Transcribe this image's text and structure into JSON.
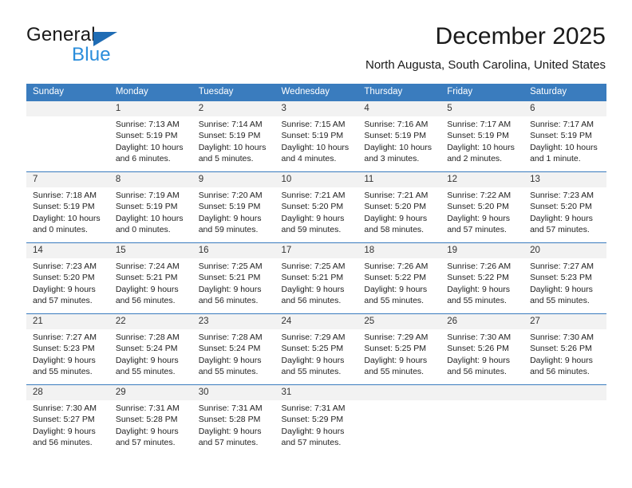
{
  "brand": {
    "word1": "General",
    "word2": "Blue",
    "triangle_color": "#1f6cb4",
    "blue_color": "#2a8ddb"
  },
  "header": {
    "title": "December 2025",
    "subtitle": "North Augusta, South Carolina, United States"
  },
  "theme": {
    "header_bg": "#3a7cbe",
    "header_text": "#ffffff",
    "daynum_bg": "#f2f2f2",
    "grid_line": "#3a7cbe"
  },
  "weekday_headers": [
    "Sunday",
    "Monday",
    "Tuesday",
    "Wednesday",
    "Thursday",
    "Friday",
    "Saturday"
  ],
  "weeks": [
    [
      {
        "day": "",
        "lines": []
      },
      {
        "day": "1",
        "lines": [
          "Sunrise: 7:13 AM",
          "Sunset: 5:19 PM",
          "Daylight: 10 hours",
          "and 6 minutes."
        ]
      },
      {
        "day": "2",
        "lines": [
          "Sunrise: 7:14 AM",
          "Sunset: 5:19 PM",
          "Daylight: 10 hours",
          "and 5 minutes."
        ]
      },
      {
        "day": "3",
        "lines": [
          "Sunrise: 7:15 AM",
          "Sunset: 5:19 PM",
          "Daylight: 10 hours",
          "and 4 minutes."
        ]
      },
      {
        "day": "4",
        "lines": [
          "Sunrise: 7:16 AM",
          "Sunset: 5:19 PM",
          "Daylight: 10 hours",
          "and 3 minutes."
        ]
      },
      {
        "day": "5",
        "lines": [
          "Sunrise: 7:17 AM",
          "Sunset: 5:19 PM",
          "Daylight: 10 hours",
          "and 2 minutes."
        ]
      },
      {
        "day": "6",
        "lines": [
          "Sunrise: 7:17 AM",
          "Sunset: 5:19 PM",
          "Daylight: 10 hours",
          "and 1 minute."
        ]
      }
    ],
    [
      {
        "day": "7",
        "lines": [
          "Sunrise: 7:18 AM",
          "Sunset: 5:19 PM",
          "Daylight: 10 hours",
          "and 0 minutes."
        ]
      },
      {
        "day": "8",
        "lines": [
          "Sunrise: 7:19 AM",
          "Sunset: 5:19 PM",
          "Daylight: 10 hours",
          "and 0 minutes."
        ]
      },
      {
        "day": "9",
        "lines": [
          "Sunrise: 7:20 AM",
          "Sunset: 5:19 PM",
          "Daylight: 9 hours",
          "and 59 minutes."
        ]
      },
      {
        "day": "10",
        "lines": [
          "Sunrise: 7:21 AM",
          "Sunset: 5:20 PM",
          "Daylight: 9 hours",
          "and 59 minutes."
        ]
      },
      {
        "day": "11",
        "lines": [
          "Sunrise: 7:21 AM",
          "Sunset: 5:20 PM",
          "Daylight: 9 hours",
          "and 58 minutes."
        ]
      },
      {
        "day": "12",
        "lines": [
          "Sunrise: 7:22 AM",
          "Sunset: 5:20 PM",
          "Daylight: 9 hours",
          "and 57 minutes."
        ]
      },
      {
        "day": "13",
        "lines": [
          "Sunrise: 7:23 AM",
          "Sunset: 5:20 PM",
          "Daylight: 9 hours",
          "and 57 minutes."
        ]
      }
    ],
    [
      {
        "day": "14",
        "lines": [
          "Sunrise: 7:23 AM",
          "Sunset: 5:20 PM",
          "Daylight: 9 hours",
          "and 57 minutes."
        ]
      },
      {
        "day": "15",
        "lines": [
          "Sunrise: 7:24 AM",
          "Sunset: 5:21 PM",
          "Daylight: 9 hours",
          "and 56 minutes."
        ]
      },
      {
        "day": "16",
        "lines": [
          "Sunrise: 7:25 AM",
          "Sunset: 5:21 PM",
          "Daylight: 9 hours",
          "and 56 minutes."
        ]
      },
      {
        "day": "17",
        "lines": [
          "Sunrise: 7:25 AM",
          "Sunset: 5:21 PM",
          "Daylight: 9 hours",
          "and 56 minutes."
        ]
      },
      {
        "day": "18",
        "lines": [
          "Sunrise: 7:26 AM",
          "Sunset: 5:22 PM",
          "Daylight: 9 hours",
          "and 55 minutes."
        ]
      },
      {
        "day": "19",
        "lines": [
          "Sunrise: 7:26 AM",
          "Sunset: 5:22 PM",
          "Daylight: 9 hours",
          "and 55 minutes."
        ]
      },
      {
        "day": "20",
        "lines": [
          "Sunrise: 7:27 AM",
          "Sunset: 5:23 PM",
          "Daylight: 9 hours",
          "and 55 minutes."
        ]
      }
    ],
    [
      {
        "day": "21",
        "lines": [
          "Sunrise: 7:27 AM",
          "Sunset: 5:23 PM",
          "Daylight: 9 hours",
          "and 55 minutes."
        ]
      },
      {
        "day": "22",
        "lines": [
          "Sunrise: 7:28 AM",
          "Sunset: 5:24 PM",
          "Daylight: 9 hours",
          "and 55 minutes."
        ]
      },
      {
        "day": "23",
        "lines": [
          "Sunrise: 7:28 AM",
          "Sunset: 5:24 PM",
          "Daylight: 9 hours",
          "and 55 minutes."
        ]
      },
      {
        "day": "24",
        "lines": [
          "Sunrise: 7:29 AM",
          "Sunset: 5:25 PM",
          "Daylight: 9 hours",
          "and 55 minutes."
        ]
      },
      {
        "day": "25",
        "lines": [
          "Sunrise: 7:29 AM",
          "Sunset: 5:25 PM",
          "Daylight: 9 hours",
          "and 55 minutes."
        ]
      },
      {
        "day": "26",
        "lines": [
          "Sunrise: 7:30 AM",
          "Sunset: 5:26 PM",
          "Daylight: 9 hours",
          "and 56 minutes."
        ]
      },
      {
        "day": "27",
        "lines": [
          "Sunrise: 7:30 AM",
          "Sunset: 5:26 PM",
          "Daylight: 9 hours",
          "and 56 minutes."
        ]
      }
    ],
    [
      {
        "day": "28",
        "lines": [
          "Sunrise: 7:30 AM",
          "Sunset: 5:27 PM",
          "Daylight: 9 hours",
          "and 56 minutes."
        ]
      },
      {
        "day": "29",
        "lines": [
          "Sunrise: 7:31 AM",
          "Sunset: 5:28 PM",
          "Daylight: 9 hours",
          "and 57 minutes."
        ]
      },
      {
        "day": "30",
        "lines": [
          "Sunrise: 7:31 AM",
          "Sunset: 5:28 PM",
          "Daylight: 9 hours",
          "and 57 minutes."
        ]
      },
      {
        "day": "31",
        "lines": [
          "Sunrise: 7:31 AM",
          "Sunset: 5:29 PM",
          "Daylight: 9 hours",
          "and 57 minutes."
        ]
      },
      {
        "day": "",
        "lines": []
      },
      {
        "day": "",
        "lines": []
      },
      {
        "day": "",
        "lines": []
      }
    ]
  ]
}
